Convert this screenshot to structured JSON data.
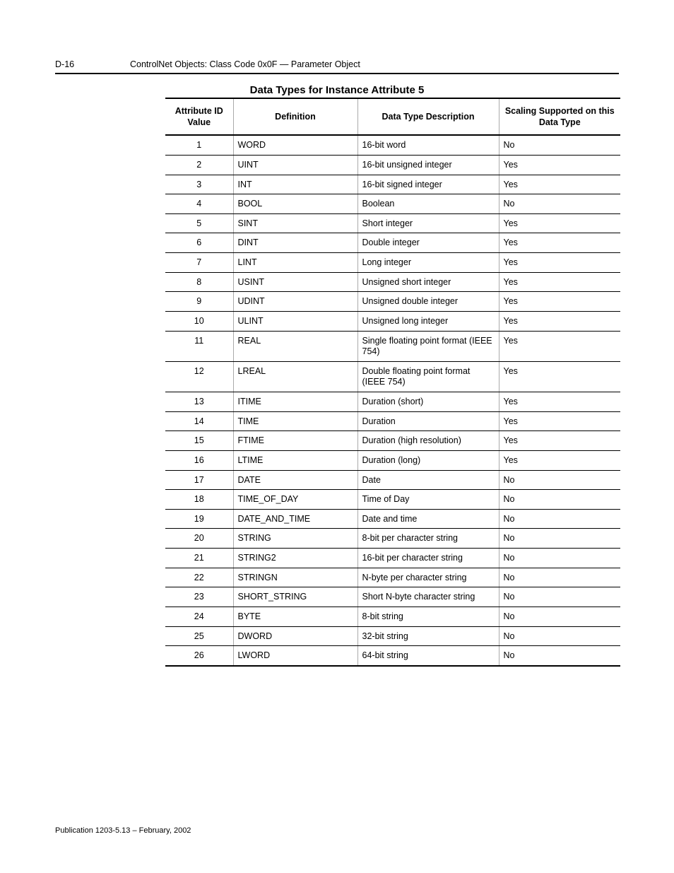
{
  "header": {
    "page_label": "D-16",
    "section": "ControlNet Objects: Class Code 0x0F — Parameter Object"
  },
  "title": "Data Types for Instance Attribute 5",
  "columns": {
    "c0": "Attribute ID Value",
    "c1": "Definition",
    "c2": "Data Type Description",
    "c3": "Scaling Supported on this Data Type"
  },
  "rows": [
    {
      "id": "1",
      "def": "WORD",
      "desc": "16-bit word",
      "scale": "No"
    },
    {
      "id": "2",
      "def": "UINT",
      "desc": "16-bit unsigned integer",
      "scale": "Yes"
    },
    {
      "id": "3",
      "def": "INT",
      "desc": "16-bit signed integer",
      "scale": "Yes"
    },
    {
      "id": "4",
      "def": "BOOL",
      "desc": "Boolean",
      "scale": "No"
    },
    {
      "id": "5",
      "def": "SINT",
      "desc": "Short integer",
      "scale": "Yes"
    },
    {
      "id": "6",
      "def": "DINT",
      "desc": "Double integer",
      "scale": "Yes"
    },
    {
      "id": "7",
      "def": "LINT",
      "desc": "Long integer",
      "scale": "Yes"
    },
    {
      "id": "8",
      "def": "USINT",
      "desc": "Unsigned short integer",
      "scale": "Yes"
    },
    {
      "id": "9",
      "def": "UDINT",
      "desc": "Unsigned double integer",
      "scale": "Yes"
    },
    {
      "id": "10",
      "def": "ULINT",
      "desc": "Unsigned long integer",
      "scale": "Yes"
    },
    {
      "id": "11",
      "def": "REAL",
      "desc": "Single floating point format (IEEE 754)",
      "scale": "Yes"
    },
    {
      "id": "12",
      "def": "LREAL",
      "desc": "Double floating point format (IEEE 754)",
      "scale": "Yes"
    },
    {
      "id": "13",
      "def": "ITIME",
      "desc": "Duration (short)",
      "scale": "Yes"
    },
    {
      "id": "14",
      "def": "TIME",
      "desc": "Duration",
      "scale": "Yes"
    },
    {
      "id": "15",
      "def": "FTIME",
      "desc": "Duration (high resolution)",
      "scale": "Yes"
    },
    {
      "id": "16",
      "def": "LTIME",
      "desc": "Duration (long)",
      "scale": "Yes"
    },
    {
      "id": "17",
      "def": "DATE",
      "desc": "Date",
      "scale": "No"
    },
    {
      "id": "18",
      "def": "TIME_OF_DAY",
      "desc": "Time of Day",
      "scale": "No"
    },
    {
      "id": "19",
      "def": "DATE_AND_TIME",
      "desc": "Date and time",
      "scale": "No"
    },
    {
      "id": "20",
      "def": "STRING",
      "desc": "8-bit per character string",
      "scale": "No"
    },
    {
      "id": "21",
      "def": "STRING2",
      "desc": "16-bit per character string",
      "scale": "No"
    },
    {
      "id": "22",
      "def": "STRINGN",
      "desc": "N-byte per character string",
      "scale": "No"
    },
    {
      "id": "23",
      "def": "SHORT_STRING",
      "desc": "Short N-byte character string",
      "scale": "No"
    },
    {
      "id": "24",
      "def": "BYTE",
      "desc": "8-bit string",
      "scale": "No"
    },
    {
      "id": "25",
      "def": "DWORD",
      "desc": "32-bit string",
      "scale": "No"
    },
    {
      "id": "26",
      "def": "LWORD",
      "desc": "64-bit string",
      "scale": "No"
    }
  ],
  "footer": "Publication 1203-5.13 – February, 2002"
}
